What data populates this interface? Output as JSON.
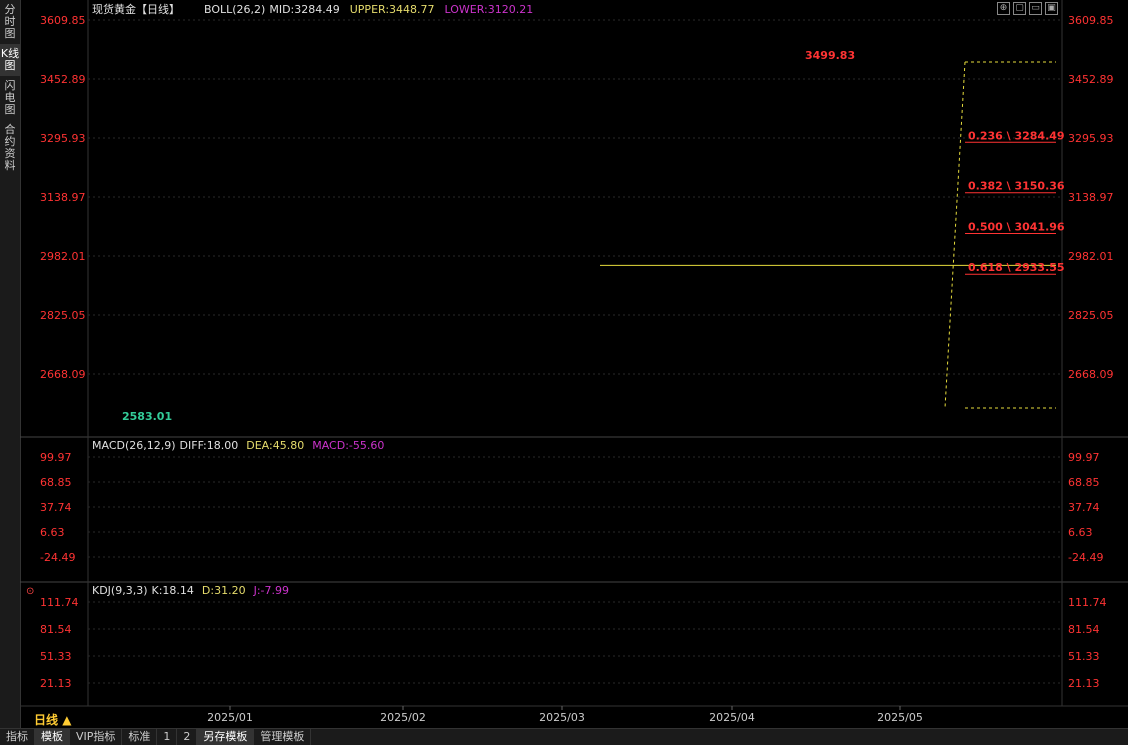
{
  "sidebar": {
    "items": [
      {
        "label": "分时图",
        "active": false
      },
      {
        "label": "K线图",
        "active": true
      },
      {
        "label": "闪电图",
        "active": false
      },
      {
        "label": "合约资料",
        "active": false
      }
    ]
  },
  "window_icons": [
    "fullscreen-icon",
    "window-icon",
    "minimize-icon",
    "close-icon"
  ],
  "colors": {
    "up": "#ff4444",
    "down": "#33cc99",
    "mid": "#e0e0e0",
    "upper": "#e6dc6c",
    "lower": "#cc33cc",
    "axis": "#ff3333",
    "grid": "#2a2a2a"
  },
  "bottom_tabs": [
    {
      "label": "指标",
      "active": false
    },
    {
      "label": "模板",
      "active": true
    },
    {
      "label": "VIP指标",
      "active": false
    },
    {
      "label": "标准",
      "active": false
    },
    {
      "label": "1",
      "active": false
    },
    {
      "label": "2",
      "active": false
    },
    {
      "label": "另存模板",
      "active": true
    },
    {
      "label": "管理模板",
      "active": false
    }
  ],
  "period_label": "日线",
  "chart_data": [
    {
      "type": "candlestick",
      "title": "现货黄金【日线】",
      "legend": {
        "boll": "BOLL(26,2)",
        "mid": "MID:3284.49",
        "upper": "UPPER:3448.77",
        "lower": "LOWER:3120.21"
      },
      "y_ticks": [
        3609.85,
        3452.89,
        3295.93,
        3138.97,
        2982.01,
        2825.05,
        2668.09
      ],
      "x_ticks": [
        "2025/01",
        "2025/02",
        "2025/03",
        "2025/04",
        "2025/05"
      ],
      "ylim": [
        2530,
        3609.85
      ],
      "annotations": {
        "high": "3499.83",
        "low": "2583.01"
      },
      "horizontal_line": 2957,
      "fibonacci": [
        {
          "label": "0.236 \\ 3284.49",
          "value": 3284.49
        },
        {
          "label": "0.382 \\ 3150.36",
          "value": 3150.36
        },
        {
          "label": "0.500 \\ 3041.96",
          "value": 3041.96
        },
        {
          "label": "0.618 \\ 2933.55",
          "value": 2933.55
        }
      ]
    },
    {
      "type": "line",
      "title": "MACD(26,12,9)",
      "legend": {
        "diff": "DIFF:18.00",
        "dea": "DEA:45.80",
        "macd": "MACD:-55.60"
      },
      "y_ticks": [
        99.97,
        68.85,
        37.74,
        6.63,
        -24.49
      ],
      "ylim": [
        -55,
        120
      ]
    },
    {
      "type": "line",
      "title": "KDJ(9,3,3)",
      "legend": {
        "k": "K:18.14",
        "d": "D:31.20",
        "j": "J:-7.99"
      },
      "y_ticks": [
        111.74,
        81.54,
        51.33,
        21.13
      ],
      "ylim": [
        -5,
        120
      ]
    }
  ]
}
